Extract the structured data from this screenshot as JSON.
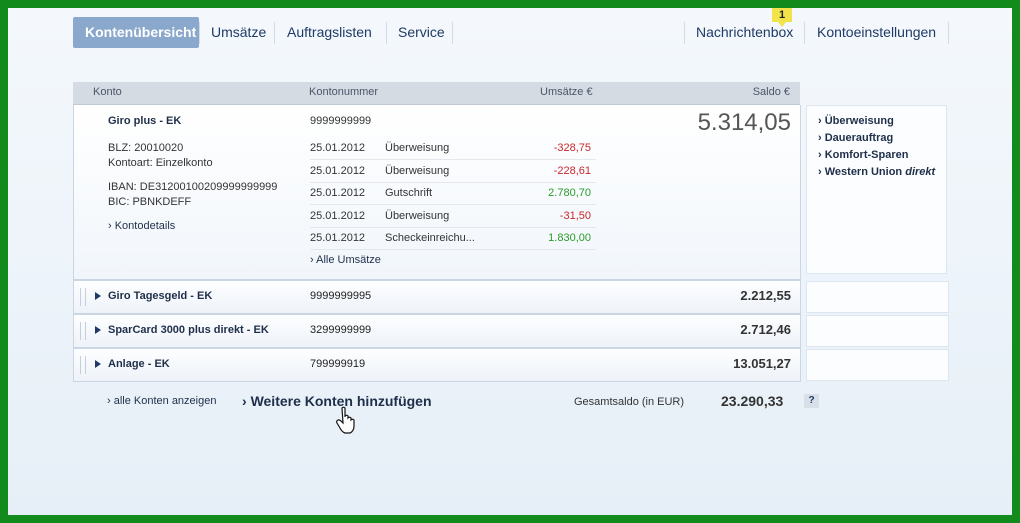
{
  "nav": {
    "tabs": [
      "Kontenübersicht",
      "Umsätze",
      "Auftragslisten",
      "Service"
    ],
    "messages": "Nachrichtenbox",
    "messages_badge": "1",
    "settings": "Kontoeinstellungen"
  },
  "table": {
    "headers": {
      "konto": "Konto",
      "kontonummer": "Kontonummer",
      "umsaetze": "Umsätze €",
      "saldo": "Saldo €"
    },
    "main_account": {
      "name": "Giro plus - EK",
      "number": "9999999999",
      "saldo": "5.314,05",
      "blz": "BLZ: 20010020",
      "kontoart": "Kontoart: Einzelkonto",
      "iban": "IBAN: DE31200100209999999999",
      "bic": "BIC: PBNKDEFF",
      "details_link": "› Kontodetails",
      "all_transactions_link": "› Alle Umsätze",
      "transactions": [
        {
          "date": "25.01.2012",
          "type": "Überweisung",
          "amount": "-328,75"
        },
        {
          "date": "25.01.2012",
          "type": "Überweisung",
          "amount": "-228,61"
        },
        {
          "date": "25.01.2012",
          "type": "Gutschrift",
          "amount": "2.780,70"
        },
        {
          "date": "25.01.2012",
          "type": "Überweisung",
          "amount": "-31,50"
        },
        {
          "date": "25.01.2012",
          "type": "Scheckeinreichu...",
          "amount": "1.830,00"
        }
      ]
    },
    "accounts": [
      {
        "name": "Giro Tagesgeld - EK",
        "number": "9999999995",
        "saldo": "2.212,55"
      },
      {
        "name": "SparCard 3000 plus direkt - EK",
        "number": "3299999999",
        "saldo": "2.712,46"
      },
      {
        "name": "Anlage - EK",
        "number": "799999919",
        "saldo": "13.051,27"
      }
    ]
  },
  "side_links": {
    "items": [
      "Überweisung",
      "Dauerauftrag",
      "Komfort-Sparen",
      "Western Union"
    ],
    "western_union_suffix": "direkt"
  },
  "footer": {
    "show_all": "› alle Konten anzeigen",
    "add_accounts": "Weitere Konten hinzufügen",
    "total_label": "Gesamtsaldo (in EUR)",
    "total_value": "23.290,33",
    "help": "?"
  }
}
